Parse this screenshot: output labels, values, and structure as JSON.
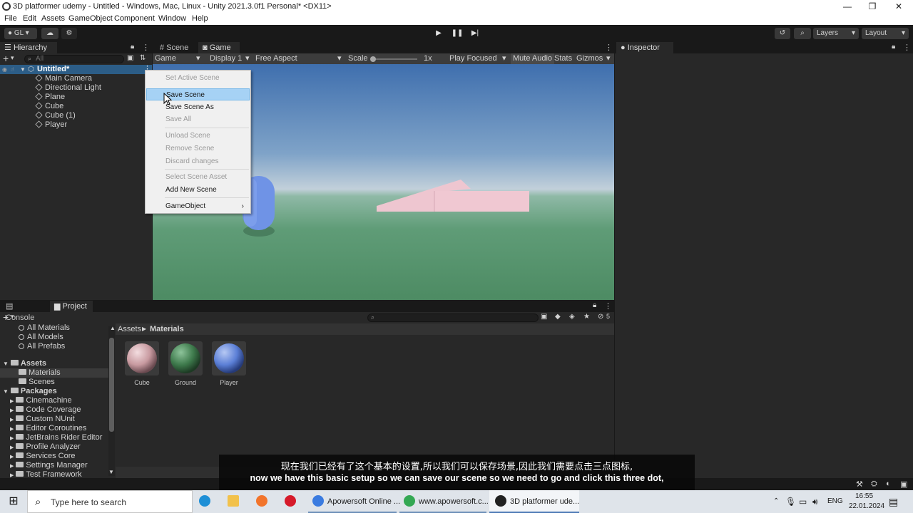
{
  "window": {
    "title": "3D platformer udemy - Untitled - Windows, Mac, Linux - Unity 2021.3.0f1 Personal* <DX11>",
    "minimize": "—",
    "maximize": "❐",
    "close": "✕"
  },
  "menu": [
    "File",
    "Edit",
    "Assets",
    "GameObject",
    "Component",
    "Window",
    "Help"
  ],
  "toolbar": {
    "account": "GL",
    "layers": "Layers",
    "layout": "Layout"
  },
  "hierarchy": {
    "tab": "Hierarchy",
    "search_placeholder": "All",
    "scene": "Untitled*",
    "items": [
      "Main Camera",
      "Directional Light",
      "Plane",
      "Cube",
      "Cube (1)",
      "Player"
    ]
  },
  "sceneview": {
    "tabs": [
      "Scene",
      "Game"
    ],
    "game_dropdown": "Game",
    "display": "Display 1",
    "aspect": "Free Aspect",
    "scale_label": "Scale",
    "scale_value": "1x",
    "play_mode": "Play Focused",
    "mute": "Mute Audio",
    "stats": "Stats",
    "gizmos": "Gizmos"
  },
  "context_menu": {
    "items": [
      {
        "label": "Set Active Scene",
        "enabled": false
      },
      {
        "label": "Save Scene",
        "enabled": true,
        "highlighted": true
      },
      {
        "label": "Save Scene As",
        "enabled": true
      },
      {
        "label": "Save All",
        "enabled": false
      },
      {
        "label": "Unload Scene",
        "enabled": false
      },
      {
        "label": "Remove Scene",
        "enabled": false
      },
      {
        "label": "Discard changes",
        "enabled": false
      },
      {
        "label": "Select Scene Asset",
        "enabled": false
      },
      {
        "label": "Add New Scene",
        "enabled": true
      },
      {
        "label": "GameObject",
        "enabled": true
      }
    ]
  },
  "inspector": {
    "tab": "Inspector"
  },
  "bottom": {
    "tabs": [
      "Console",
      "Project"
    ],
    "favorites": [
      "All Materials",
      "All Models",
      "All Prefabs"
    ],
    "assets_root": "Assets",
    "assets_children": [
      "Materials",
      "Scenes"
    ],
    "packages_root": "Packages",
    "packages": [
      "Cinemachine",
      "Code Coverage",
      "Custom NUnit",
      "Editor Coroutines",
      "JetBrains Rider Editor",
      "Profile Analyzer",
      "Services Core",
      "Settings Manager",
      "Test Framework"
    ],
    "breadcrumb_root": "Assets",
    "breadcrumb_sep": "▶",
    "breadcrumb_current": "Materials",
    "hidden_count": "5",
    "assets": [
      {
        "name": "Cube",
        "color": "#c89aa0"
      },
      {
        "name": "Ground",
        "color": "#3e7a4c"
      },
      {
        "name": "Player",
        "color": "#5b7fd6"
      }
    ]
  },
  "subtitle": {
    "zh": "现在我们已经有了这个基本的设置,所以我们可以保存场景,因此我们需要点击三点图标,",
    "en": "now we have this basic setup so we can save our scene so we need to go and click this three dot,"
  },
  "taskbar": {
    "search_placeholder": "Type here to search",
    "apps": [
      "Apowersoft Online ...",
      "www.apowersoft.c...",
      "3D platformer ude..."
    ],
    "language": "ENG",
    "time": "16:55",
    "date": "22.01.2024"
  },
  "colors": {
    "unity_highlight": "#2c5d87",
    "menu_highlight": "#a6d2f5",
    "capsule": "#6f93e6",
    "cube_pink": "#f0c8d2"
  }
}
